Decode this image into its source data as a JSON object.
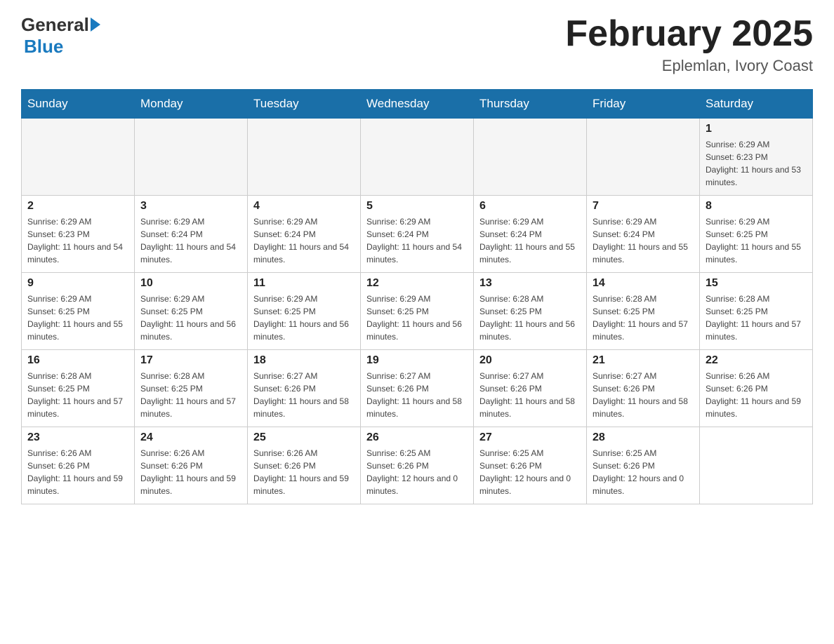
{
  "logo": {
    "general": "General",
    "blue": "Blue"
  },
  "title": {
    "month_year": "February 2025",
    "location": "Eplemlan, Ivory Coast"
  },
  "weekdays": [
    "Sunday",
    "Monday",
    "Tuesday",
    "Wednesday",
    "Thursday",
    "Friday",
    "Saturday"
  ],
  "weeks": [
    [
      {
        "day": "",
        "sunrise": "",
        "sunset": "",
        "daylight": ""
      },
      {
        "day": "",
        "sunrise": "",
        "sunset": "",
        "daylight": ""
      },
      {
        "day": "",
        "sunrise": "",
        "sunset": "",
        "daylight": ""
      },
      {
        "day": "",
        "sunrise": "",
        "sunset": "",
        "daylight": ""
      },
      {
        "day": "",
        "sunrise": "",
        "sunset": "",
        "daylight": ""
      },
      {
        "day": "",
        "sunrise": "",
        "sunset": "",
        "daylight": ""
      },
      {
        "day": "1",
        "sunrise": "Sunrise: 6:29 AM",
        "sunset": "Sunset: 6:23 PM",
        "daylight": "Daylight: 11 hours and 53 minutes."
      }
    ],
    [
      {
        "day": "2",
        "sunrise": "Sunrise: 6:29 AM",
        "sunset": "Sunset: 6:23 PM",
        "daylight": "Daylight: 11 hours and 54 minutes."
      },
      {
        "day": "3",
        "sunrise": "Sunrise: 6:29 AM",
        "sunset": "Sunset: 6:24 PM",
        "daylight": "Daylight: 11 hours and 54 minutes."
      },
      {
        "day": "4",
        "sunrise": "Sunrise: 6:29 AM",
        "sunset": "Sunset: 6:24 PM",
        "daylight": "Daylight: 11 hours and 54 minutes."
      },
      {
        "day": "5",
        "sunrise": "Sunrise: 6:29 AM",
        "sunset": "Sunset: 6:24 PM",
        "daylight": "Daylight: 11 hours and 54 minutes."
      },
      {
        "day": "6",
        "sunrise": "Sunrise: 6:29 AM",
        "sunset": "Sunset: 6:24 PM",
        "daylight": "Daylight: 11 hours and 55 minutes."
      },
      {
        "day": "7",
        "sunrise": "Sunrise: 6:29 AM",
        "sunset": "Sunset: 6:24 PM",
        "daylight": "Daylight: 11 hours and 55 minutes."
      },
      {
        "day": "8",
        "sunrise": "Sunrise: 6:29 AM",
        "sunset": "Sunset: 6:25 PM",
        "daylight": "Daylight: 11 hours and 55 minutes."
      }
    ],
    [
      {
        "day": "9",
        "sunrise": "Sunrise: 6:29 AM",
        "sunset": "Sunset: 6:25 PM",
        "daylight": "Daylight: 11 hours and 55 minutes."
      },
      {
        "day": "10",
        "sunrise": "Sunrise: 6:29 AM",
        "sunset": "Sunset: 6:25 PM",
        "daylight": "Daylight: 11 hours and 56 minutes."
      },
      {
        "day": "11",
        "sunrise": "Sunrise: 6:29 AM",
        "sunset": "Sunset: 6:25 PM",
        "daylight": "Daylight: 11 hours and 56 minutes."
      },
      {
        "day": "12",
        "sunrise": "Sunrise: 6:29 AM",
        "sunset": "Sunset: 6:25 PM",
        "daylight": "Daylight: 11 hours and 56 minutes."
      },
      {
        "day": "13",
        "sunrise": "Sunrise: 6:28 AM",
        "sunset": "Sunset: 6:25 PM",
        "daylight": "Daylight: 11 hours and 56 minutes."
      },
      {
        "day": "14",
        "sunrise": "Sunrise: 6:28 AM",
        "sunset": "Sunset: 6:25 PM",
        "daylight": "Daylight: 11 hours and 57 minutes."
      },
      {
        "day": "15",
        "sunrise": "Sunrise: 6:28 AM",
        "sunset": "Sunset: 6:25 PM",
        "daylight": "Daylight: 11 hours and 57 minutes."
      }
    ],
    [
      {
        "day": "16",
        "sunrise": "Sunrise: 6:28 AM",
        "sunset": "Sunset: 6:25 PM",
        "daylight": "Daylight: 11 hours and 57 minutes."
      },
      {
        "day": "17",
        "sunrise": "Sunrise: 6:28 AM",
        "sunset": "Sunset: 6:25 PM",
        "daylight": "Daylight: 11 hours and 57 minutes."
      },
      {
        "day": "18",
        "sunrise": "Sunrise: 6:27 AM",
        "sunset": "Sunset: 6:26 PM",
        "daylight": "Daylight: 11 hours and 58 minutes."
      },
      {
        "day": "19",
        "sunrise": "Sunrise: 6:27 AM",
        "sunset": "Sunset: 6:26 PM",
        "daylight": "Daylight: 11 hours and 58 minutes."
      },
      {
        "day": "20",
        "sunrise": "Sunrise: 6:27 AM",
        "sunset": "Sunset: 6:26 PM",
        "daylight": "Daylight: 11 hours and 58 minutes."
      },
      {
        "day": "21",
        "sunrise": "Sunrise: 6:27 AM",
        "sunset": "Sunset: 6:26 PM",
        "daylight": "Daylight: 11 hours and 58 minutes."
      },
      {
        "day": "22",
        "sunrise": "Sunrise: 6:26 AM",
        "sunset": "Sunset: 6:26 PM",
        "daylight": "Daylight: 11 hours and 59 minutes."
      }
    ],
    [
      {
        "day": "23",
        "sunrise": "Sunrise: 6:26 AM",
        "sunset": "Sunset: 6:26 PM",
        "daylight": "Daylight: 11 hours and 59 minutes."
      },
      {
        "day": "24",
        "sunrise": "Sunrise: 6:26 AM",
        "sunset": "Sunset: 6:26 PM",
        "daylight": "Daylight: 11 hours and 59 minutes."
      },
      {
        "day": "25",
        "sunrise": "Sunrise: 6:26 AM",
        "sunset": "Sunset: 6:26 PM",
        "daylight": "Daylight: 11 hours and 59 minutes."
      },
      {
        "day": "26",
        "sunrise": "Sunrise: 6:25 AM",
        "sunset": "Sunset: 6:26 PM",
        "daylight": "Daylight: 12 hours and 0 minutes."
      },
      {
        "day": "27",
        "sunrise": "Sunrise: 6:25 AM",
        "sunset": "Sunset: 6:26 PM",
        "daylight": "Daylight: 12 hours and 0 minutes."
      },
      {
        "day": "28",
        "sunrise": "Sunrise: 6:25 AM",
        "sunset": "Sunset: 6:26 PM",
        "daylight": "Daylight: 12 hours and 0 minutes."
      },
      {
        "day": "",
        "sunrise": "",
        "sunset": "",
        "daylight": ""
      }
    ]
  ]
}
